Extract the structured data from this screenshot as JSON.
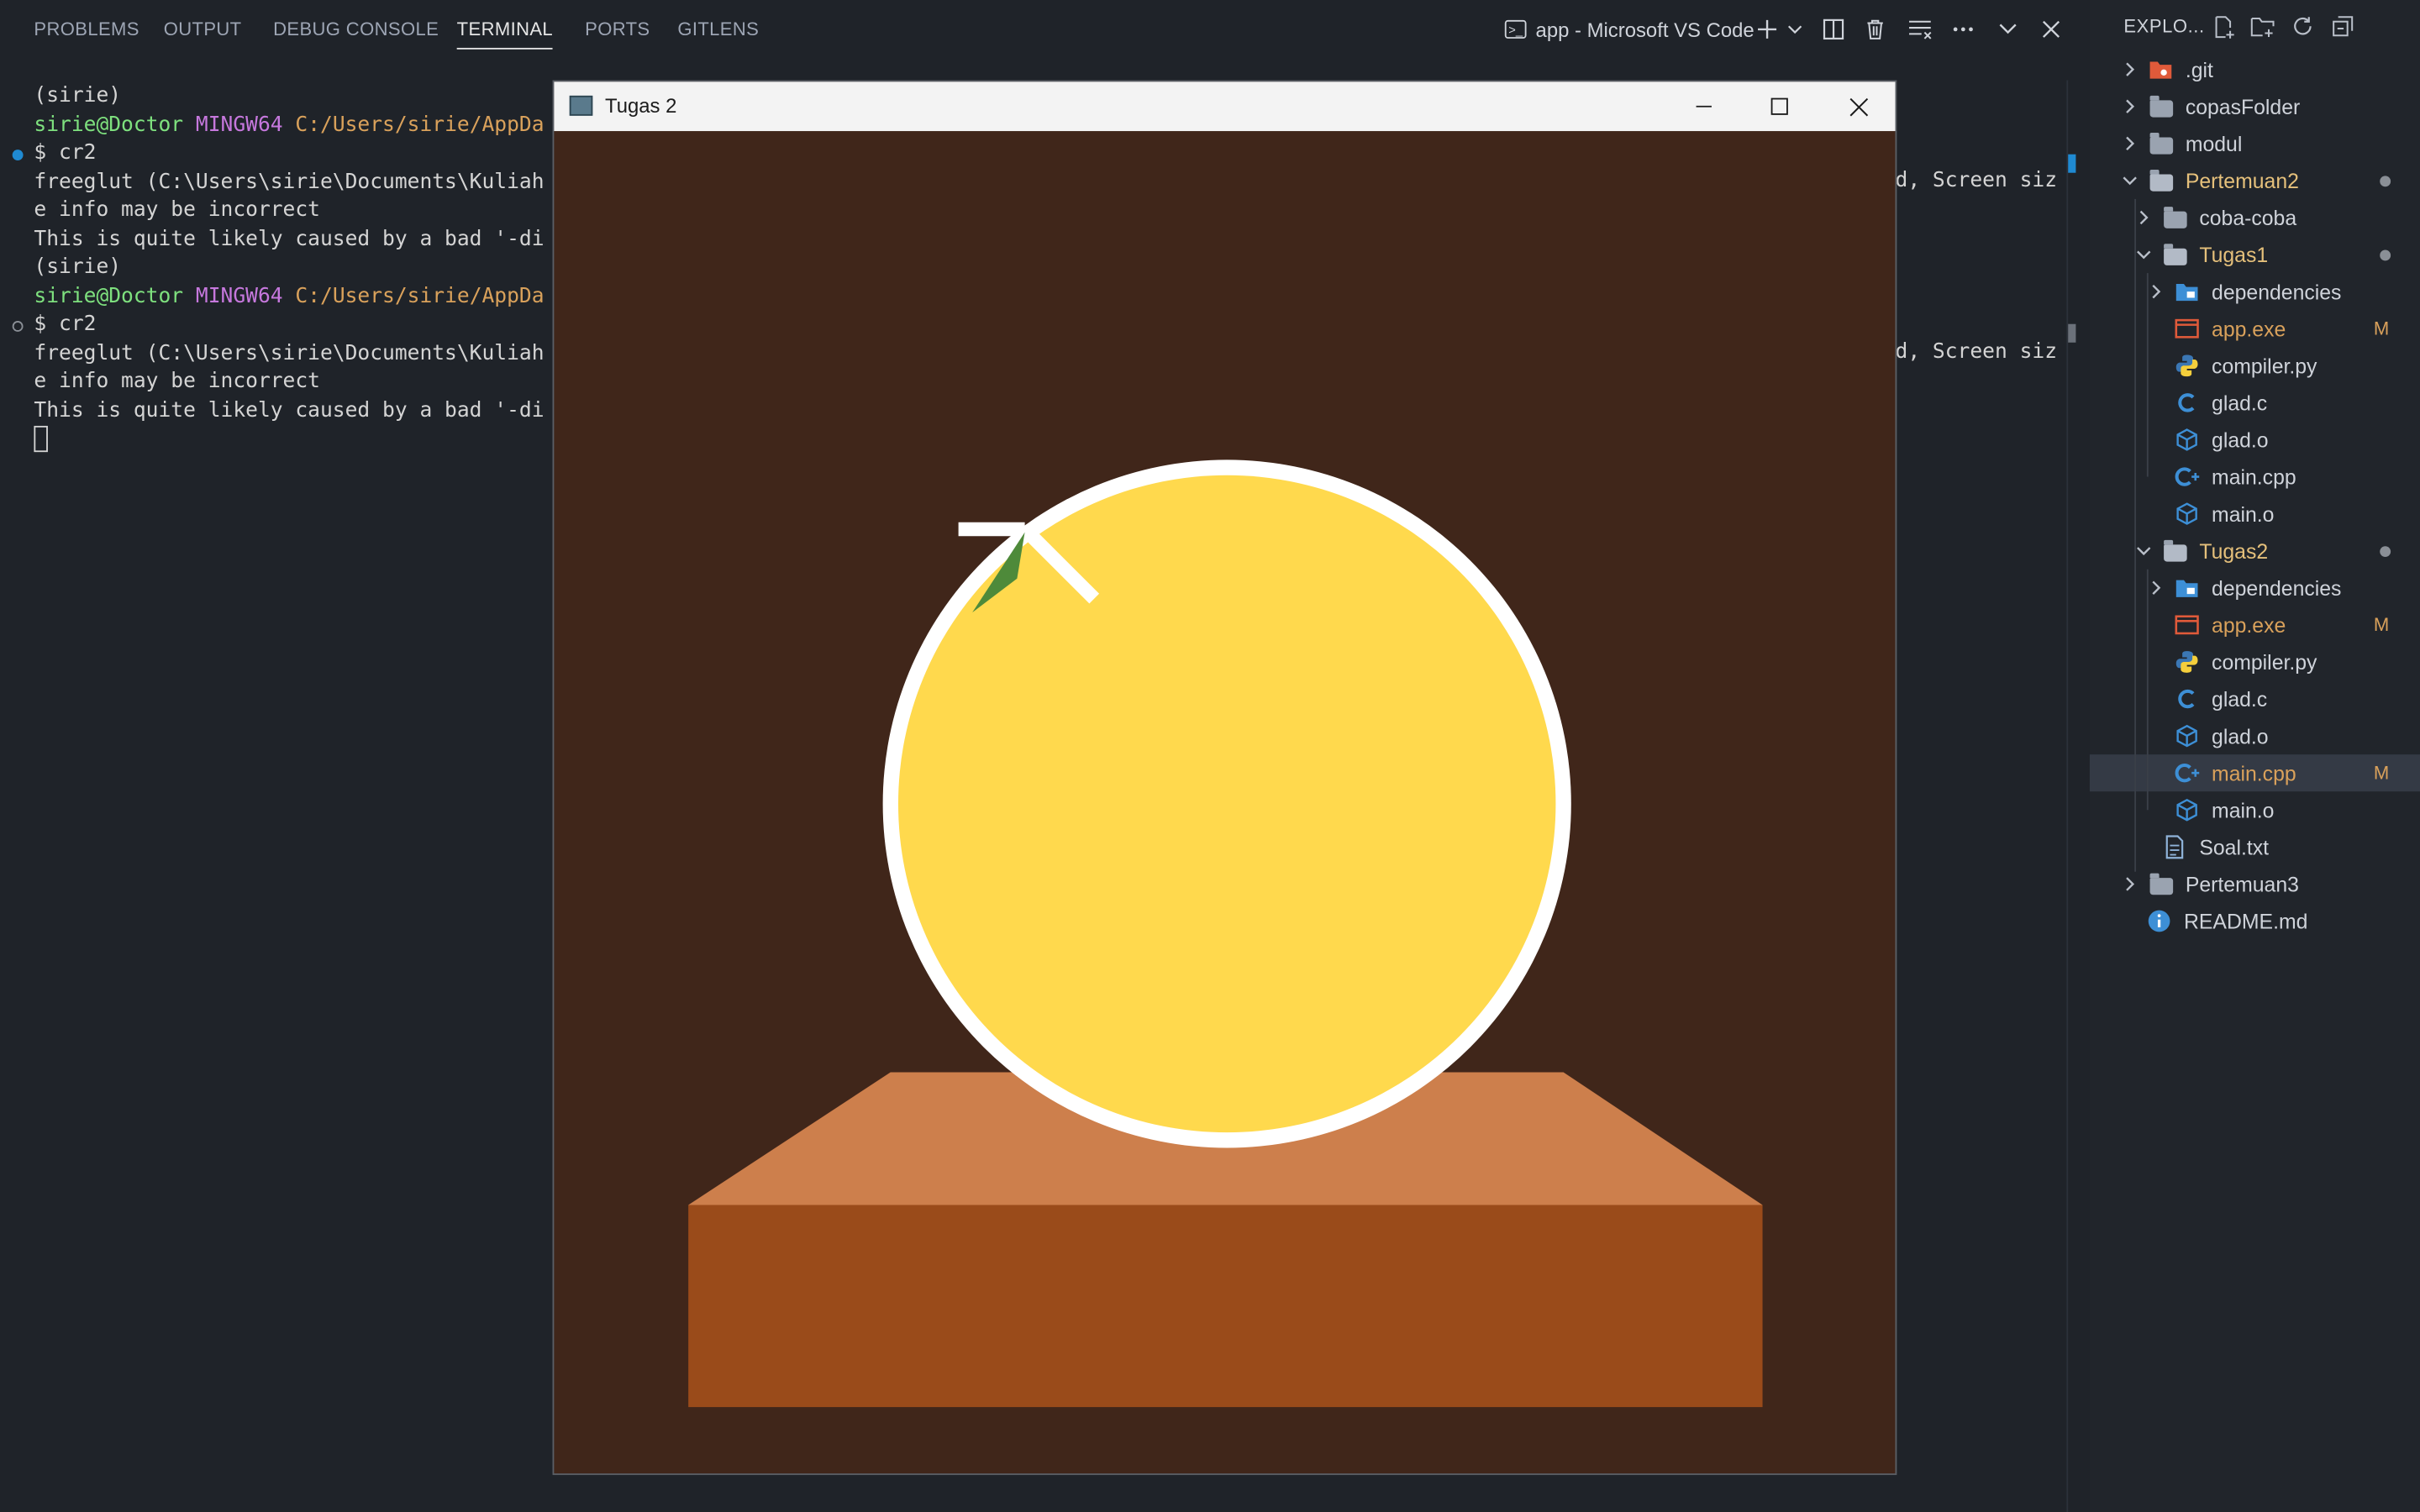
{
  "panel": {
    "tabs": [
      "PROBLEMS",
      "OUTPUT",
      "DEBUG CONSOLE",
      "TERMINAL",
      "PORTS",
      "GITLENS"
    ],
    "active_tab": "TERMINAL",
    "terminal_title": "app - Microsoft VS Code"
  },
  "terminal": {
    "lines": [
      {
        "kind": "plain",
        "text": "(sirie)"
      },
      {
        "kind": "prompt",
        "user": "sirie@Doctor",
        "env": "MINGW64",
        "path": "C:/Users/sirie/AppDa"
      },
      {
        "kind": "cmd",
        "text": "$ cr2",
        "marker": "blue"
      },
      {
        "kind": "plain",
        "text": "freeglut (C:\\Users\\sirie\\Documents\\Kuliah",
        "tail": "d, Screen siz"
      },
      {
        "kind": "plain",
        "text": "e info may be incorrect"
      },
      {
        "kind": "plain",
        "text": "This is quite likely caused by a bad '-di"
      },
      {
        "kind": "plain",
        "text": "(sirie)"
      },
      {
        "kind": "prompt",
        "user": "sirie@Doctor",
        "env": "MINGW64",
        "path": "C:/Users/sirie/AppDa"
      },
      {
        "kind": "cmd",
        "text": "$ cr2",
        "marker": "hollow"
      },
      {
        "kind": "plain",
        "text": "freeglut (C:\\Users\\sirie\\Documents\\Kuliah",
        "tail": "d, Screen siz"
      },
      {
        "kind": "plain",
        "text": "e info may be incorrect"
      },
      {
        "kind": "plain",
        "text": "This is quite likely caused by a bad '-di"
      },
      {
        "kind": "cursor",
        "text": ""
      }
    ]
  },
  "explorer": {
    "title": "EXPLO...",
    "items": [
      {
        "label": ".git",
        "depth": 0,
        "type": "folder",
        "icon": "git-folder-icon",
        "expanded": false
      },
      {
        "label": "copasFolder",
        "depth": 0,
        "type": "folder",
        "expanded": false
      },
      {
        "label": "modul",
        "depth": 0,
        "type": "folder",
        "expanded": false
      },
      {
        "label": "Pertemuan2",
        "depth": 0,
        "type": "folder",
        "expanded": true,
        "modified": true,
        "dot": true
      },
      {
        "label": "coba-coba",
        "depth": 1,
        "type": "folder",
        "expanded": false
      },
      {
        "label": "Tugas1",
        "depth": 1,
        "type": "folder",
        "expanded": true,
        "modified": true,
        "dot": true
      },
      {
        "label": "dependencies",
        "depth": 2,
        "type": "folder",
        "expanded": false,
        "icon": "special-folder-icon"
      },
      {
        "label": "app.exe",
        "depth": 2,
        "type": "file",
        "icon": "exe-file-icon",
        "modified": true,
        "badge": "M"
      },
      {
        "label": "compiler.py",
        "depth": 2,
        "type": "file",
        "icon": "python-file-icon"
      },
      {
        "label": "glad.c",
        "depth": 2,
        "type": "file",
        "icon": "c-file-icon"
      },
      {
        "label": "glad.o",
        "depth": 2,
        "type": "file",
        "icon": "object-file-icon"
      },
      {
        "label": "main.cpp",
        "depth": 2,
        "type": "file",
        "icon": "cpp-file-icon"
      },
      {
        "label": "main.o",
        "depth": 2,
        "type": "file",
        "icon": "object-file-icon"
      },
      {
        "label": "Tugas2",
        "depth": 1,
        "type": "folder",
        "expanded": true,
        "modified": true,
        "dot": true
      },
      {
        "label": "dependencies",
        "depth": 2,
        "type": "folder",
        "expanded": false,
        "icon": "special-folder-icon"
      },
      {
        "label": "app.exe",
        "depth": 2,
        "type": "file",
        "icon": "exe-file-icon",
        "modified": true,
        "badge": "M"
      },
      {
        "label": "compiler.py",
        "depth": 2,
        "type": "file",
        "icon": "python-file-icon"
      },
      {
        "label": "glad.c",
        "depth": 2,
        "type": "file",
        "icon": "c-file-icon"
      },
      {
        "label": "glad.o",
        "depth": 2,
        "type": "file",
        "icon": "object-file-icon"
      },
      {
        "label": "main.cpp",
        "depth": 2,
        "type": "file",
        "icon": "cpp-file-icon",
        "modified": true,
        "badge": "M",
        "selected": true
      },
      {
        "label": "main.o",
        "depth": 2,
        "type": "file",
        "icon": "object-file-icon"
      },
      {
        "label": "Soal.txt",
        "depth": 1,
        "type": "file",
        "icon": "text-file-icon"
      },
      {
        "label": "Pertemuan3",
        "depth": 0,
        "type": "folder",
        "expanded": false
      },
      {
        "label": "README.md",
        "depth": 0,
        "type": "file",
        "icon": "info-file-icon"
      }
    ]
  },
  "glut_window": {
    "title": "Tugas 2"
  },
  "colors": {
    "scene_background": "#40261a",
    "table_top": "#cd7f4c",
    "table_front": "#9a4b1a",
    "fruit": "#ffd94d",
    "fruit_outline": "#ffffff",
    "leaf": "#4e8a3a",
    "modified": "#d9a15b",
    "folder_modified": "#e5c07b"
  }
}
